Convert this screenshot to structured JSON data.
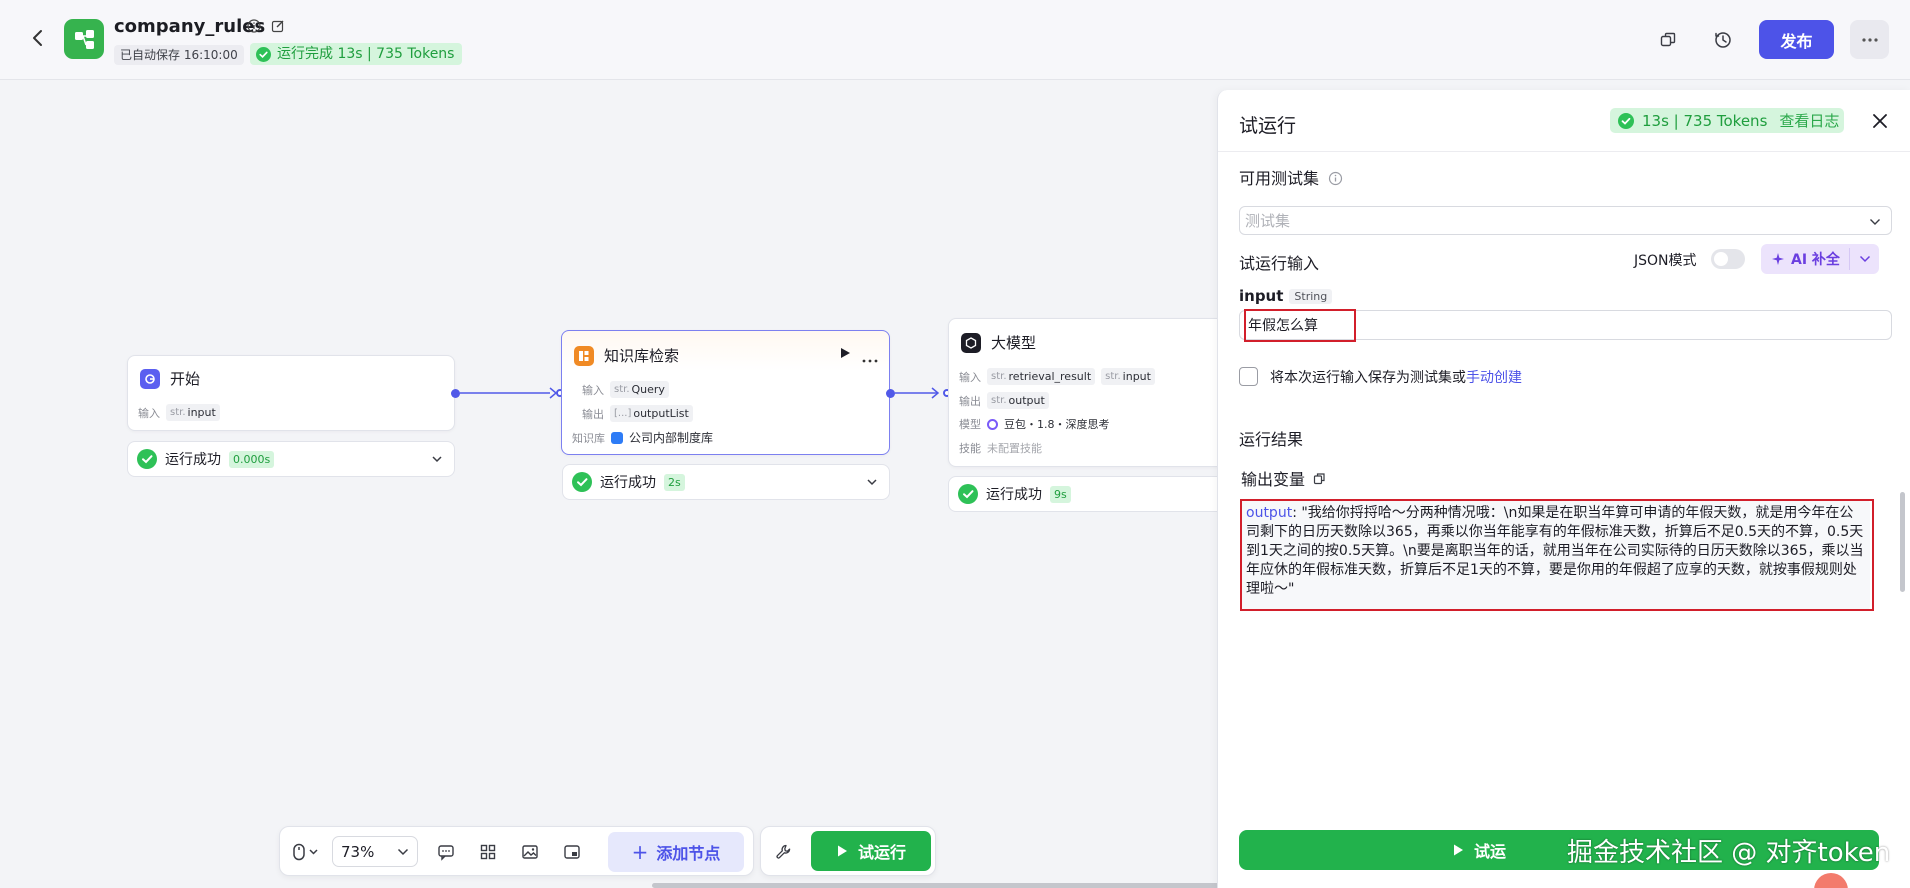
{
  "header": {
    "app_title": "company_rules",
    "autosave": "已自动保存 16:10:00",
    "run_status": "运行完成 13s | 735 Tokens",
    "publish_label": "发布"
  },
  "nodes": {
    "start": {
      "title": "开始",
      "input_label": "输入",
      "input_type": "str.",
      "input_name": "input",
      "status": "运行成功",
      "time": "0.000s"
    },
    "knowledge": {
      "title": "知识库检索",
      "input_label": "输入",
      "input_type": "str.",
      "input_name": "Query",
      "output_label": "输出",
      "output_type": "[...]",
      "output_name": "outputList",
      "kb_label": "知识库",
      "kb_name": "公司内部制度库",
      "status": "运行成功",
      "time": "2s"
    },
    "llm": {
      "title": "大模型",
      "input_label": "输入",
      "input_type_1": "str.",
      "input_name_1": "retrieval_result",
      "input_type_2": "str.",
      "input_name_2": "input",
      "output_label": "输出",
      "output_type": "str.",
      "output_name": "output",
      "model_label": "模型",
      "model_name": "豆包・1.8・深度思考",
      "skill_label": "技能",
      "skill_value": "未配置技能",
      "status": "运行成功",
      "time": "9s"
    }
  },
  "toolbar": {
    "zoom": "73%",
    "add_node_label": "添加节点",
    "test_run_label": "试运行"
  },
  "panel": {
    "title": "试运行",
    "badge_text": "13s | 735 Tokens",
    "view_log": "查看日志",
    "test_set_label": "可用测试集",
    "test_set_placeholder": "测试集",
    "run_input_label": "试运行输入",
    "json_mode_label": "JSON模式",
    "ai_fill_label": "AI 补全",
    "input_name": "input",
    "input_type": "String",
    "input_value": "年假怎么算",
    "save_text": "将本次运行输入保存为测试集或",
    "manual_create": "手动创建",
    "result_title": "运行结果",
    "output_var_title": "输出变量",
    "output_key": "output",
    "output_value": ": \"我给你捋捋哈～分两种情况哦：\\n如果是在职当年算可申请的年假天数，就是用今年在公司剩下的日历天数除以365，再乘以你当年能享有的年假标准天数，折算后不足0.5天的不算，0.5天到1天之间的按0.5天算。\\n要是离职当年的话，就用当年在公司实际待的日历天数除以365，乘以当年应休的年假标准天数，折算后不足1天的不算，要是你用的年假超了应享的天数，就按事假规则处理啦～\"",
    "run_button_label": "试运",
    "watermark": "掘金技术社区 @ 对齐token"
  },
  "colors": {
    "accent": "#4d53e8",
    "success": "#22b24c",
    "highlight": "#d21f2b"
  }
}
